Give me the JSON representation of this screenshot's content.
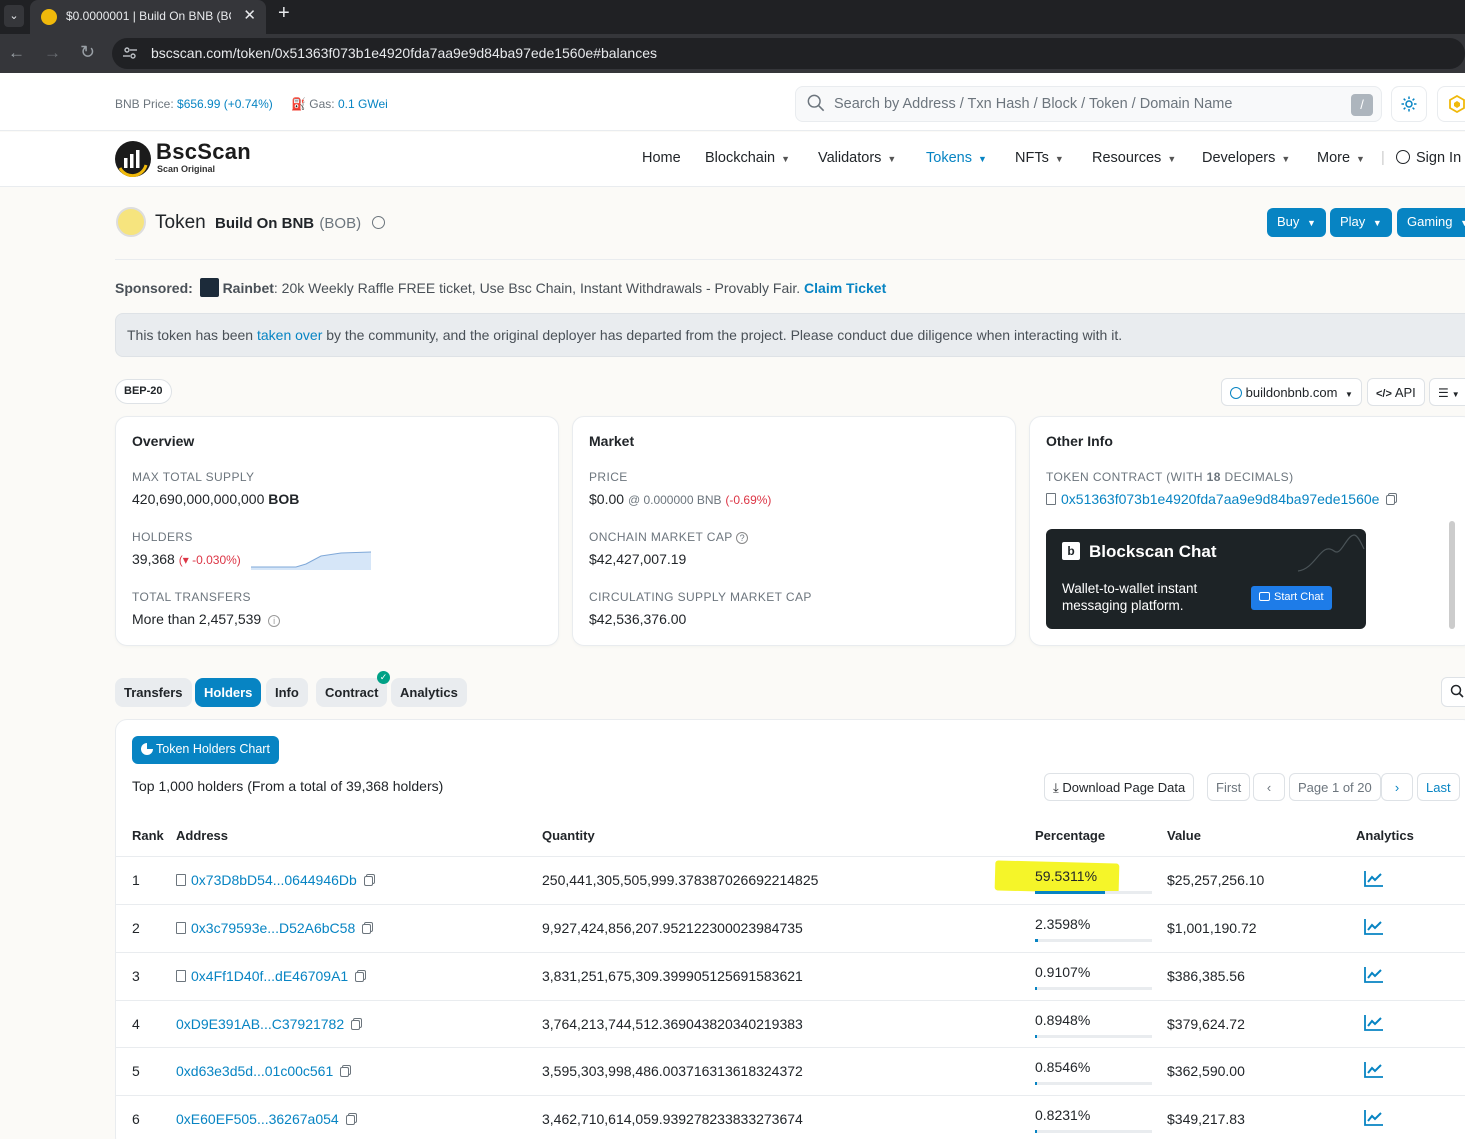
{
  "browser": {
    "tab_title": "$0.0000001 | Build On BNB (BO",
    "tab_close": "✕",
    "new_tab": "+",
    "dropdown": "⌄",
    "back": "←",
    "forward": "→",
    "reload": "↻",
    "url": "bscscan.com/token/0x51363f073b1e4920fda7aa9e9d84ba97ede1560e#balances"
  },
  "topbar": {
    "bnb_price_label": "BNB Price:",
    "bnb_price": "$656.99 (+0.74%)",
    "gas_label": "Gas:",
    "gas_value": "0.1 GWei",
    "search_placeholder": "Search by Address / Txn Hash / Block / Token / Domain Name",
    "search_shortcut": "/"
  },
  "header": {
    "logo_title": "BscScan",
    "logo_subtitle": "Scan Original",
    "nav": [
      "Home",
      "Blockchain",
      "Validators",
      "Tokens",
      "NFTs",
      "Resources",
      "Developers",
      "More"
    ],
    "sign_in": "Sign In",
    "separator": "|"
  },
  "token": {
    "label": "Token",
    "name": "Build On BNB",
    "symbol": "(BOB)",
    "buttons": [
      "Buy",
      "Play",
      "Gaming"
    ]
  },
  "sponsored": {
    "label": "Sponsored:",
    "brand": "Rainbet",
    "text": ": 20k Weekly Raffle FREE ticket, Use Bsc Chain, Instant Withdrawals - Provably Fair.",
    "cta": "Claim Ticket"
  },
  "alert": {
    "before": "This token has been ",
    "link": "taken over",
    "after": " by the community, and the original deployer has departed from the project. Please conduct due diligence when interacting with it."
  },
  "badges": {
    "standard": "BEP-20",
    "website": "buildonbnb.com",
    "api": "API"
  },
  "overview": {
    "title": "Overview",
    "max_supply_label": "MAX TOTAL SUPPLY",
    "max_supply": "420,690,000,000,000",
    "max_supply_symbol": "BOB",
    "holders_label": "HOLDERS",
    "holders": "39,368",
    "holders_change": "-0.030%",
    "transfers_label": "TOTAL TRANSFERS",
    "transfers": "More than 2,457,539"
  },
  "market": {
    "title": "Market",
    "price_label": "PRICE",
    "price": "$0.00",
    "price_bnb": "@ 0.000000 BNB",
    "price_change": "(-0.69%)",
    "mcap_label": "ONCHAIN MARKET CAP",
    "mcap": "$42,427,007.19",
    "circ_label": "CIRCULATING SUPPLY MARKET CAP",
    "circ": "$42,536,376.00"
  },
  "other": {
    "title": "Other Info",
    "contract_label_pre": "TOKEN CONTRACT (WITH ",
    "decimals": "18",
    "contract_label_post": " DECIMALS)",
    "contract": "0x51363f073b1e4920fda7aa9e9d84ba97ede1560e",
    "chat_title": "Blockscan Chat",
    "chat_text": "Wallet-to-wallet instant messaging platform.",
    "chat_btn": "Start Chat"
  },
  "tabs": [
    "Transfers",
    "Holders",
    "Info",
    "Contract",
    "Analytics"
  ],
  "holders": {
    "chart_btn": "Token Holders Chart",
    "summary": "Top 1,000 holders (From a total of 39,368 holders)",
    "download": "Download Page Data",
    "first": "First",
    "page": "Page 1 of 20",
    "last": "Last",
    "columns": [
      "Rank",
      "Address",
      "Quantity",
      "Percentage",
      "Value",
      "Analytics"
    ],
    "rows": [
      {
        "rank": "1",
        "address": "0x73D8bD54...0644946Db",
        "quantity": "250,441,305,505,999.378387026692214825",
        "percentage": "59.5311%",
        "value": "$25,257,256.10",
        "pct": 59.5311,
        "contract": true
      },
      {
        "rank": "2",
        "address": "0x3c79593e...D52A6bC58",
        "quantity": "9,927,424,856,207.952122300023984735",
        "percentage": "2.3598%",
        "value": "$1,001,190.72",
        "pct": 2.3598,
        "contract": true
      },
      {
        "rank": "3",
        "address": "0x4Ff1D40f...dE46709A1",
        "quantity": "3,831,251,675,309.399905125691583621",
        "percentage": "0.9107%",
        "value": "$386,385.56",
        "pct": 0.9107,
        "contract": true
      },
      {
        "rank": "4",
        "address": "0xD9E391AB...C37921782",
        "quantity": "3,764,213,744,512.369043820340219383",
        "percentage": "0.8948%",
        "value": "$379,624.72",
        "pct": 0.8948,
        "contract": false
      },
      {
        "rank": "5",
        "address": "0xd63e3d5d...01c00c561",
        "quantity": "3,595,303,998,486.003716313618324372",
        "percentage": "0.8546%",
        "value": "$362,590.00",
        "pct": 0.8546,
        "contract": false
      },
      {
        "rank": "6",
        "address": "0xE60EF505...36267a054",
        "quantity": "3,462,710,614,059.939278233833273674",
        "percentage": "0.8231%",
        "value": "$349,217.83",
        "pct": 0.8231,
        "contract": false
      }
    ]
  },
  "colors": {
    "accent": "#0784c3",
    "danger": "#dc3545",
    "highlight": "#f4f41e"
  }
}
